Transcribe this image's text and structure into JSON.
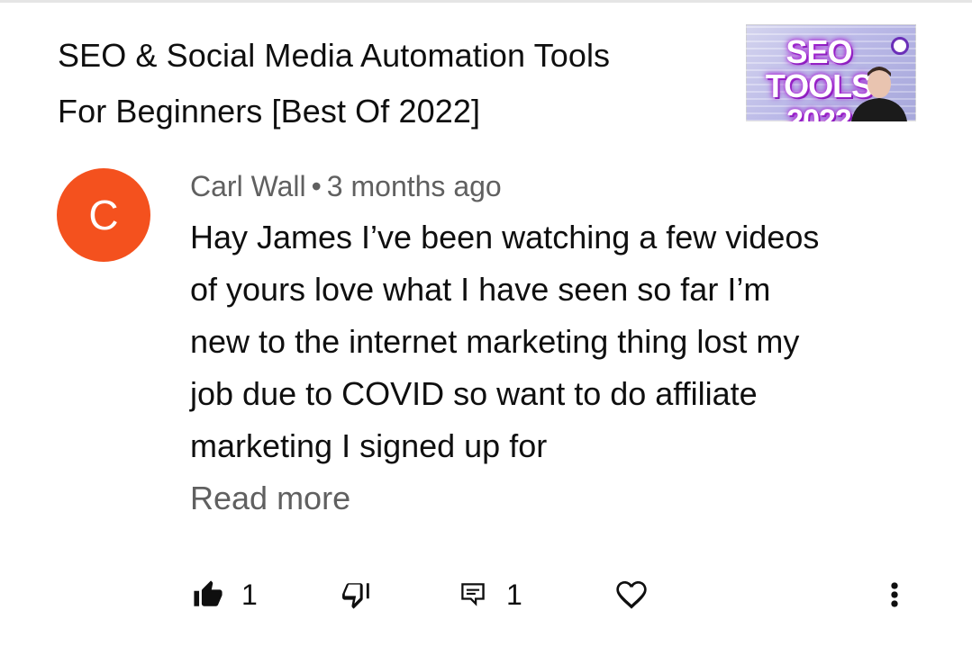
{
  "video": {
    "title_line1": "SEO & Social Media Automation Tools",
    "title_line2": "For Beginners [Best Of 2022]",
    "thumbnail": {
      "line1": "SEO TOOLS",
      "line2": "2022"
    }
  },
  "comment": {
    "avatar_letter": "C",
    "avatar_color": "#f4511e",
    "author": "Carl Wall",
    "separator": "•",
    "timestamp": "3 months ago",
    "text": "Hay James I’ve been watching a few videos of yours love what I have seen so far I’m new to the internet marketing thing lost my job due to COVID so want to do affiliate marketing I signed up for",
    "read_more": "Read more"
  },
  "actions": {
    "like_icon": "thumbs-up-filled-icon",
    "like_count": "1",
    "dislike_icon": "thumbs-down-icon",
    "reply_icon": "reply-comment-icon",
    "reply_count": "1",
    "heart_icon": "heart-outline-icon",
    "more_icon": "more-vertical-icon"
  }
}
